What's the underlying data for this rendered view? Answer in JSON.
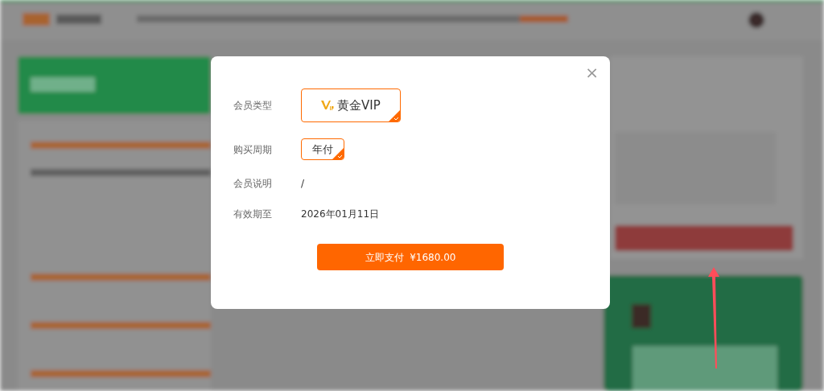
{
  "dialog": {
    "close": "×",
    "rows": [
      {
        "kind": "options",
        "label": "会员类型",
        "options": [
          {
            "text": "黄金VIP",
            "vip": true,
            "selected": true
          }
        ]
      },
      {
        "kind": "options",
        "label": "购买周期",
        "options": [
          {
            "text": "年付",
            "vip": false,
            "selected": true
          }
        ]
      },
      {
        "kind": "text",
        "label": "会员说明",
        "value": "/"
      },
      {
        "kind": "text",
        "label": "有效期至",
        "value": "2026年01月11日"
      }
    ],
    "pay_button": "立即支付  ¥1680.00"
  }
}
